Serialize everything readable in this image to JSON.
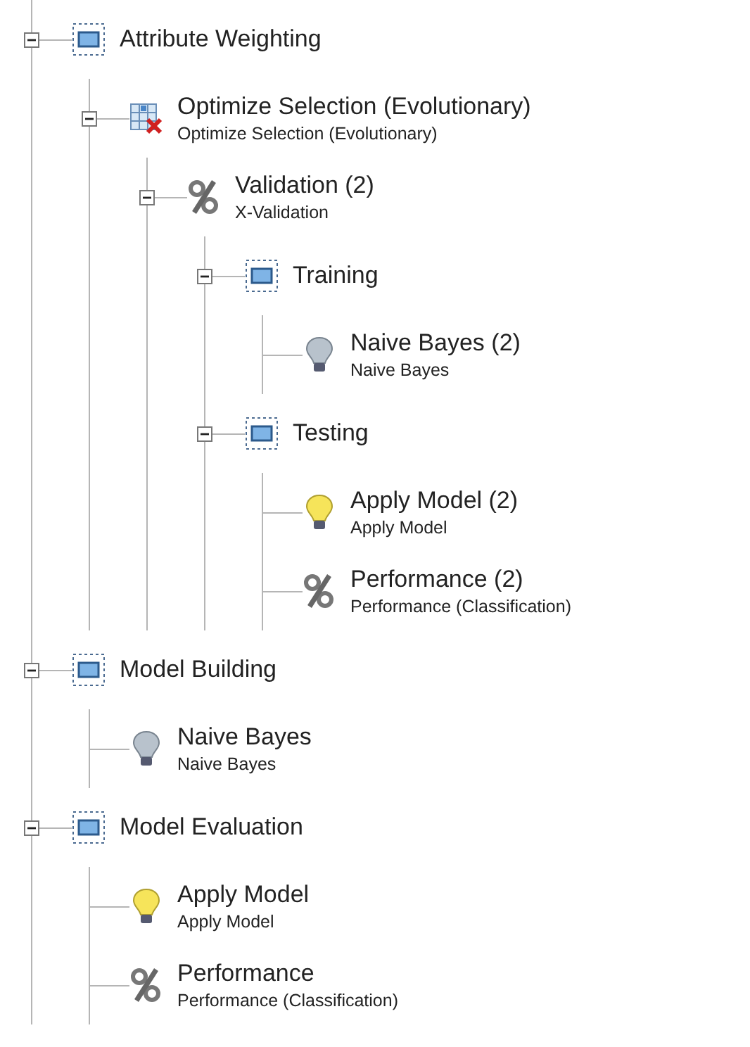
{
  "tree": [
    {
      "kind": "subprocess",
      "title": "Attribute Weighting",
      "expanded": true,
      "children": [
        {
          "kind": "optimize",
          "title": "Optimize Selection (Evolutionary)",
          "subtitle": "Optimize Selection (Evolutionary)",
          "expanded": true,
          "children": [
            {
              "kind": "validation",
              "title": "Validation (2)",
              "subtitle": "X-Validation",
              "expanded": true,
              "children": [
                {
                  "kind": "subprocess",
                  "title": "Training",
                  "expanded": true,
                  "children": [
                    {
                      "kind": "learner",
                      "title": "Naive Bayes (2)",
                      "subtitle": "Naive Bayes"
                    }
                  ]
                },
                {
                  "kind": "subprocess",
                  "title": "Testing",
                  "expanded": true,
                  "children": [
                    {
                      "kind": "apply",
                      "title": "Apply Model (2)",
                      "subtitle": "Apply Model"
                    },
                    {
                      "kind": "performance",
                      "title": "Performance (2)",
                      "subtitle": "Performance (Classification)"
                    }
                  ]
                }
              ]
            }
          ]
        }
      ]
    },
    {
      "kind": "subprocess",
      "title": "Model Building",
      "expanded": true,
      "children": [
        {
          "kind": "learner",
          "title": "Naive Bayes",
          "subtitle": "Naive Bayes"
        }
      ]
    },
    {
      "kind": "subprocess",
      "title": "Model Evaluation",
      "expanded": true,
      "children": [
        {
          "kind": "apply",
          "title": "Apply Model",
          "subtitle": "Apply Model"
        },
        {
          "kind": "performance",
          "title": "Performance",
          "subtitle": "Performance (Classification)"
        }
      ]
    }
  ]
}
